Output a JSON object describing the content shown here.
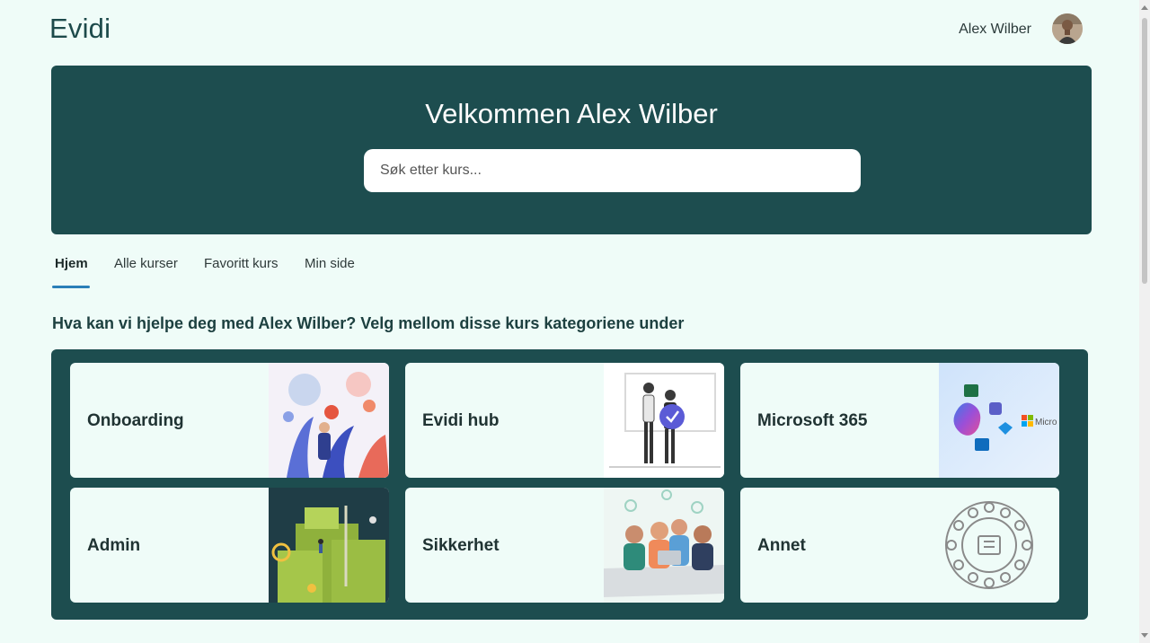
{
  "header": {
    "logo": "Evidi",
    "user_name": "Alex Wilber"
  },
  "hero": {
    "title": "Velkommen Alex Wilber",
    "search_placeholder": "Søk etter kurs..."
  },
  "tabs": [
    {
      "label": "Hjem",
      "active": true
    },
    {
      "label": "Alle kurser",
      "active": false
    },
    {
      "label": "Favoritt kurs",
      "active": false
    },
    {
      "label": "Min side",
      "active": false
    }
  ],
  "section": {
    "heading": "Hva kan vi hjelpe deg med Alex Wilber? Velg mellom disse kurs kategoriene under"
  },
  "categories": [
    {
      "label": "Onboarding",
      "image": "onboarding-illustration"
    },
    {
      "label": "Evidi hub",
      "image": "evidi-hub-illustration"
    },
    {
      "label": "Microsoft 365",
      "image": "microsoft-365-illustration"
    },
    {
      "label": "Admin",
      "image": "admin-illustration"
    },
    {
      "label": "Sikkerhet",
      "image": "security-illustration"
    },
    {
      "label": "Annet",
      "image": "other-icons-illustration"
    }
  ],
  "microsoft_logo_text": "Micro",
  "colors": {
    "page_background": "#effcf8",
    "panel_background": "#1d4d4f",
    "accent_underline": "#2a7fb8"
  }
}
